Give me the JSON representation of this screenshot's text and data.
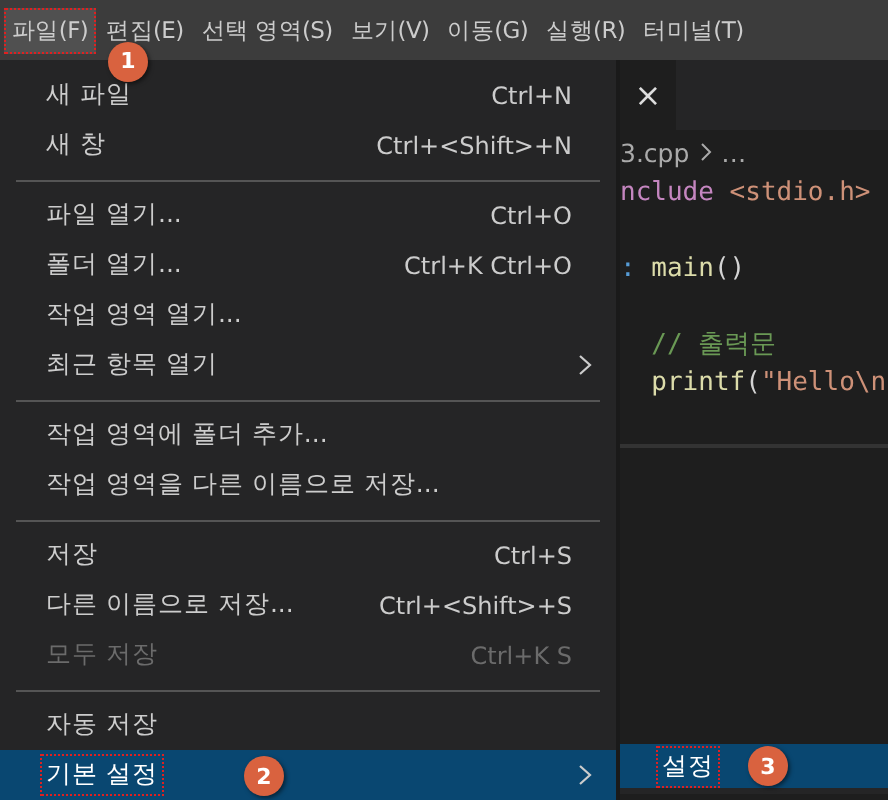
{
  "menubar": [
    {
      "label": "파일(F)",
      "selected": true,
      "outlined": true,
      "badge": "1"
    },
    {
      "label": "편집(E)",
      "selected": false,
      "outlined": false
    },
    {
      "label": "선택 영역(S)",
      "selected": false,
      "outlined": false
    },
    {
      "label": "보기(V)",
      "selected": false,
      "outlined": false
    },
    {
      "label": "이동(G)",
      "selected": false,
      "outlined": false
    },
    {
      "label": "실행(R)",
      "selected": false,
      "outlined": false
    },
    {
      "label": "터미널(T)",
      "selected": false,
      "outlined": false
    }
  ],
  "file_menu": [
    {
      "kind": "item",
      "label": "새 파일",
      "shortcut": "Ctrl+N",
      "disabled": false,
      "submenu": false,
      "selected": false
    },
    {
      "kind": "item",
      "label": "새 창",
      "shortcut": "Ctrl+<Shift>+N",
      "disabled": false,
      "submenu": false,
      "selected": false
    },
    {
      "kind": "separator"
    },
    {
      "kind": "item",
      "label": "파일 열기...",
      "shortcut": "Ctrl+O",
      "disabled": false,
      "submenu": false,
      "selected": false
    },
    {
      "kind": "item",
      "label": "폴더 열기...",
      "shortcut": "Ctrl+K Ctrl+O",
      "disabled": false,
      "submenu": false,
      "selected": false
    },
    {
      "kind": "item",
      "label": "작업 영역 열기...",
      "disabled": false,
      "submenu": false,
      "selected": false
    },
    {
      "kind": "item",
      "label": "최근 항목 열기",
      "disabled": false,
      "submenu": true,
      "selected": false
    },
    {
      "kind": "separator"
    },
    {
      "kind": "item",
      "label": "작업 영역에 폴더 추가...",
      "disabled": false,
      "submenu": false,
      "selected": false
    },
    {
      "kind": "item",
      "label": "작업 영역을 다른 이름으로 저장...",
      "disabled": false,
      "submenu": false,
      "selected": false
    },
    {
      "kind": "separator"
    },
    {
      "kind": "item",
      "label": "저장",
      "shortcut": "Ctrl+S",
      "disabled": false,
      "submenu": false,
      "selected": false
    },
    {
      "kind": "item",
      "label": "다른 이름으로 저장...",
      "shortcut": "Ctrl+<Shift>+S",
      "disabled": false,
      "submenu": false,
      "selected": false
    },
    {
      "kind": "item",
      "label": "모두 저장",
      "shortcut": "Ctrl+K S",
      "disabled": true,
      "submenu": false,
      "selected": false
    },
    {
      "kind": "separator"
    },
    {
      "kind": "item",
      "label": "자동 저장",
      "disabled": false,
      "submenu": false,
      "selected": false
    },
    {
      "kind": "item",
      "label": "기본 설정",
      "disabled": false,
      "submenu": true,
      "selected": true,
      "outlined": true,
      "badge": "2"
    }
  ],
  "editor": {
    "tab_close": "×",
    "breadcrumb": [
      "3.cpp",
      "…"
    ],
    "code_lines": [
      {
        "kind": "code",
        "tokens": [
          {
            "kind": "keyword",
            "text": "nclude"
          },
          {
            "kind": "string",
            "text": " <stdio.h>"
          }
        ]
      },
      {
        "kind": "blank"
      },
      {
        "kind": "code",
        "tokens": [
          {
            "kind": "type",
            "text": ":"
          },
          {
            "kind": "function",
            "text": " main"
          },
          {
            "kind": "plain",
            "text": "()"
          }
        ]
      },
      {
        "kind": "blank"
      },
      {
        "kind": "code",
        "tokens": [
          {
            "kind": "comment",
            "text": "  // 출력문"
          }
        ]
      },
      {
        "kind": "code",
        "tokens": [
          {
            "kind": "function",
            "text": "  printf"
          },
          {
            "kind": "plain",
            "text": "("
          },
          {
            "kind": "string",
            "text": "\"Hello\\n"
          }
        ]
      }
    ]
  },
  "submenu": [
    {
      "label": "설정",
      "selected": true,
      "outlined": true,
      "badge": "3"
    }
  ]
}
